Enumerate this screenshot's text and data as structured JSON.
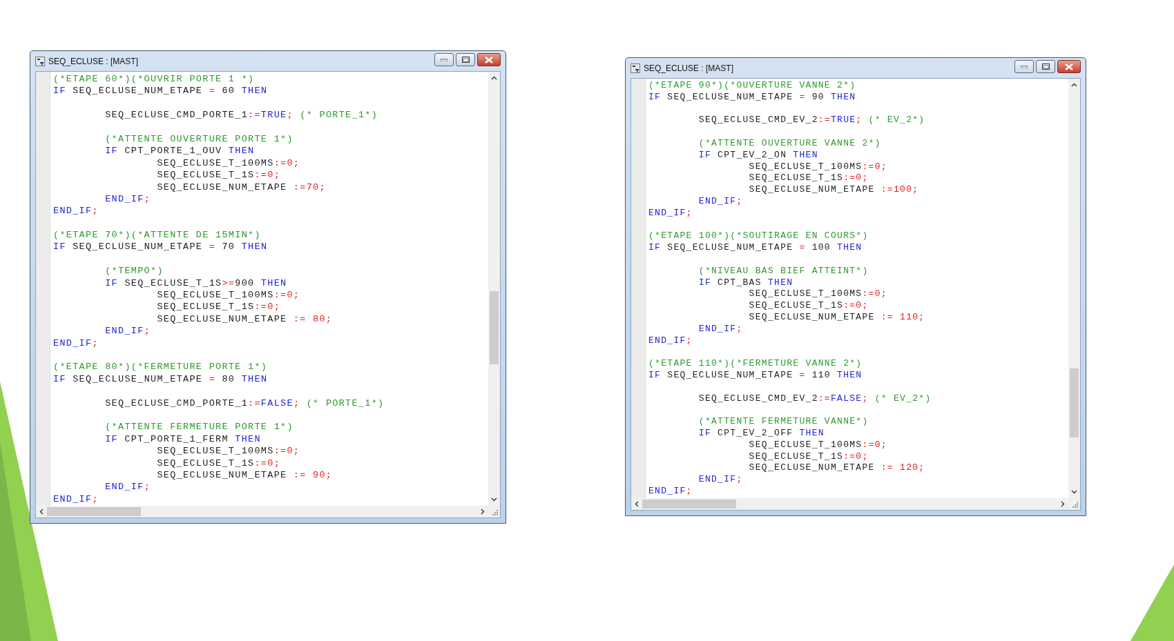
{
  "windows": [
    {
      "title": "SEQ_ECLUSE : [MAST]",
      "lines": [
        {
          "tokens": [
            {
              "kind": "comment",
              "text": "(*ETAPE 60*)(*OUVRIR PORTE 1 *)"
            }
          ]
        },
        {
          "tokens": [
            {
              "kind": "kw",
              "text": "IF"
            },
            {
              "kind": "id",
              "text": " SEQ_ECLUSE_NUM_ETAPE "
            },
            {
              "kind": "op",
              "text": "="
            },
            {
              "kind": "id",
              "text": " 60 "
            },
            {
              "kind": "kw",
              "text": "THEN"
            }
          ]
        },
        {
          "after_blank": true,
          "tokens": [
            {
              "kind": "id",
              "text": "        SEQ_ECLUSE_CMD_PORTE_1"
            },
            {
              "kind": "op",
              "text": ":="
            },
            {
              "kind": "kw",
              "text": "TRUE"
            },
            {
              "kind": "op",
              "text": ";"
            },
            {
              "kind": "comment",
              "text": " (* PORTE_1*)"
            }
          ]
        },
        {
          "after_blank": true,
          "tokens": [
            {
              "kind": "comment",
              "text": "        (*ATTENTE OUVERTURE PORTE 1*)"
            }
          ]
        },
        {
          "tokens": [
            {
              "kind": "kw",
              "text": "        IF"
            },
            {
              "kind": "id",
              "text": " CPT_PORTE_1_OUV "
            },
            {
              "kind": "kw",
              "text": "THEN"
            }
          ]
        },
        {
          "tokens": [
            {
              "kind": "id",
              "text": "                SEQ_ECLUSE_T_100MS"
            },
            {
              "kind": "op",
              "text": ":=0;"
            }
          ]
        },
        {
          "tokens": [
            {
              "kind": "id",
              "text": "                SEQ_ECLUSE_T_1S"
            },
            {
              "kind": "op",
              "text": ":=0;"
            }
          ]
        },
        {
          "tokens": [
            {
              "kind": "id",
              "text": "                SEQ_ECLUSE_NUM_ETAPE "
            },
            {
              "kind": "op",
              "text": ":=70;"
            }
          ]
        },
        {
          "tokens": [
            {
              "kind": "kw",
              "text": "        END_IF"
            },
            {
              "kind": "op",
              "text": ";"
            }
          ]
        },
        {
          "tokens": [
            {
              "kind": "kw",
              "text": "END_IF"
            },
            {
              "kind": "op",
              "text": ";"
            }
          ]
        },
        {
          "after_blank": true,
          "tokens": [
            {
              "kind": "comment",
              "text": "(*ETAPE 70*)(*ATTENTE DE 15MIN*)"
            }
          ]
        },
        {
          "tokens": [
            {
              "kind": "kw",
              "text": "IF"
            },
            {
              "kind": "id",
              "text": " SEQ_ECLUSE_NUM_ETAPE "
            },
            {
              "kind": "op",
              "text": "="
            },
            {
              "kind": "id",
              "text": " 70 "
            },
            {
              "kind": "kw",
              "text": "THEN"
            }
          ]
        },
        {
          "after_blank": true,
          "tokens": [
            {
              "kind": "comment",
              "text": "        (*TEMPO*)"
            }
          ]
        },
        {
          "tokens": [
            {
              "kind": "kw",
              "text": "        IF"
            },
            {
              "kind": "id",
              "text": " SEQ_ECLUSE_T_1S"
            },
            {
              "kind": "op",
              "text": ">="
            },
            {
              "kind": "id",
              "text": "900 "
            },
            {
              "kind": "kw",
              "text": "THEN"
            }
          ]
        },
        {
          "tokens": [
            {
              "kind": "id",
              "text": "                SEQ_ECLUSE_T_100MS"
            },
            {
              "kind": "op",
              "text": ":=0;"
            }
          ]
        },
        {
          "tokens": [
            {
              "kind": "id",
              "text": "                SEQ_ECLUSE_T_1S"
            },
            {
              "kind": "op",
              "text": ":=0;"
            }
          ]
        },
        {
          "tokens": [
            {
              "kind": "id",
              "text": "                SEQ_ECLUSE_NUM_ETAPE "
            },
            {
              "kind": "op",
              "text": ":= 80;"
            }
          ]
        },
        {
          "tokens": [
            {
              "kind": "kw",
              "text": "        END_IF"
            },
            {
              "kind": "op",
              "text": ";"
            }
          ]
        },
        {
          "tokens": [
            {
              "kind": "kw",
              "text": "END_IF"
            },
            {
              "kind": "op",
              "text": ";"
            }
          ]
        },
        {
          "after_blank": true,
          "tokens": [
            {
              "kind": "comment",
              "text": "(*ETAPE 80*)(*FERMETURE PORTE 1*)"
            }
          ]
        },
        {
          "tokens": [
            {
              "kind": "kw",
              "text": "IF"
            },
            {
              "kind": "id",
              "text": " SEQ_ECLUSE_NUM_ETAPE "
            },
            {
              "kind": "op",
              "text": "="
            },
            {
              "kind": "id",
              "text": " 80 "
            },
            {
              "kind": "kw",
              "text": "THEN"
            }
          ]
        },
        {
          "after_blank": true,
          "tokens": [
            {
              "kind": "id",
              "text": "        SEQ_ECLUSE_CMD_PORTE_1"
            },
            {
              "kind": "op",
              "text": ":="
            },
            {
              "kind": "kw",
              "text": "FALSE"
            },
            {
              "kind": "op",
              "text": ";"
            },
            {
              "kind": "comment",
              "text": " (* PORTE_1*)"
            }
          ]
        },
        {
          "after_blank": true,
          "tokens": [
            {
              "kind": "comment",
              "text": "        (*ATTENTE FERMETURE PORTE 1*)"
            }
          ]
        },
        {
          "tokens": [
            {
              "kind": "kw",
              "text": "        IF"
            },
            {
              "kind": "id",
              "text": " CPT_PORTE_1_FERM "
            },
            {
              "kind": "kw",
              "text": "THEN"
            }
          ]
        },
        {
          "tokens": [
            {
              "kind": "id",
              "text": "                SEQ_ECLUSE_T_100MS"
            },
            {
              "kind": "op",
              "text": ":=0;"
            }
          ]
        },
        {
          "tokens": [
            {
              "kind": "id",
              "text": "                SEQ_ECLUSE_T_1S"
            },
            {
              "kind": "op",
              "text": ":=0;"
            }
          ]
        },
        {
          "tokens": [
            {
              "kind": "id",
              "text": "                SEQ_ECLUSE_NUM_ETAPE "
            },
            {
              "kind": "op",
              "text": ":= 90;"
            }
          ]
        },
        {
          "tokens": [
            {
              "kind": "kw",
              "text": "        END_IF"
            },
            {
              "kind": "op",
              "text": ";"
            }
          ]
        },
        {
          "tokens": [
            {
              "kind": "kw",
              "text": "END_IF"
            },
            {
              "kind": "op",
              "text": ";"
            }
          ]
        }
      ]
    },
    {
      "title": "SEQ_ECLUSE : [MAST]",
      "lines": [
        {
          "tokens": [
            {
              "kind": "comment",
              "text": "(*ETAPE 90*)(*OUVERTURE VANNE 2*)"
            }
          ]
        },
        {
          "tokens": [
            {
              "kind": "kw",
              "text": "IF"
            },
            {
              "kind": "id",
              "text": " SEQ_ECLUSE_NUM_ETAPE "
            },
            {
              "kind": "op",
              "text": "="
            },
            {
              "kind": "id",
              "text": " 90 "
            },
            {
              "kind": "kw",
              "text": "THEN"
            }
          ]
        },
        {
          "after_blank": true,
          "tokens": [
            {
              "kind": "id",
              "text": "        SEQ_ECLUSE_CMD_EV_2"
            },
            {
              "kind": "op",
              "text": ":="
            },
            {
              "kind": "kw",
              "text": "TRUE"
            },
            {
              "kind": "op",
              "text": ";"
            },
            {
              "kind": "comment",
              "text": " (* EV_2*)"
            }
          ]
        },
        {
          "after_blank": true,
          "tokens": [
            {
              "kind": "comment",
              "text": "        (*ATTENTE OUVERTURE VANNE 2*)"
            }
          ]
        },
        {
          "tokens": [
            {
              "kind": "kw",
              "text": "        IF"
            },
            {
              "kind": "id",
              "text": " CPT_EV_2_ON "
            },
            {
              "kind": "kw",
              "text": "THEN"
            }
          ]
        },
        {
          "tokens": [
            {
              "kind": "id",
              "text": "                SEQ_ECLUSE_T_100MS"
            },
            {
              "kind": "op",
              "text": ":=0;"
            }
          ]
        },
        {
          "tokens": [
            {
              "kind": "id",
              "text": "                SEQ_ECLUSE_T_1S"
            },
            {
              "kind": "op",
              "text": ":=0;"
            }
          ]
        },
        {
          "tokens": [
            {
              "kind": "id",
              "text": "                SEQ_ECLUSE_NUM_ETAPE "
            },
            {
              "kind": "op",
              "text": ":=100;"
            }
          ]
        },
        {
          "tokens": [
            {
              "kind": "kw",
              "text": "        END_IF"
            },
            {
              "kind": "op",
              "text": ";"
            }
          ]
        },
        {
          "tokens": [
            {
              "kind": "kw",
              "text": "END_IF"
            },
            {
              "kind": "op",
              "text": ";"
            }
          ]
        },
        {
          "after_blank": true,
          "tokens": [
            {
              "kind": "comment",
              "text": "(*ETAPE 100*)(*SOUTIRAGE EN COURS*)"
            }
          ]
        },
        {
          "tokens": [
            {
              "kind": "kw",
              "text": "IF"
            },
            {
              "kind": "id",
              "text": " SEQ_ECLUSE_NUM_ETAPE "
            },
            {
              "kind": "op",
              "text": "="
            },
            {
              "kind": "id",
              "text": " 100 "
            },
            {
              "kind": "kw",
              "text": "THEN"
            }
          ]
        },
        {
          "after_blank": true,
          "tokens": [
            {
              "kind": "comment",
              "text": "        (*NIVEAU BAS BIEF ATTEINT*)"
            }
          ]
        },
        {
          "tokens": [
            {
              "kind": "kw",
              "text": "        IF"
            },
            {
              "kind": "id",
              "text": " CPT_BAS "
            },
            {
              "kind": "kw",
              "text": "THEN"
            }
          ]
        },
        {
          "tokens": [
            {
              "kind": "id",
              "text": "                SEQ_ECLUSE_T_100MS"
            },
            {
              "kind": "op",
              "text": ":=0;"
            }
          ]
        },
        {
          "tokens": [
            {
              "kind": "id",
              "text": "                SEQ_ECLUSE_T_1S"
            },
            {
              "kind": "op",
              "text": ":=0;"
            }
          ]
        },
        {
          "tokens": [
            {
              "kind": "id",
              "text": "                SEQ_ECLUSE_NUM_ETAPE "
            },
            {
              "kind": "op",
              "text": ":= 110;"
            }
          ]
        },
        {
          "tokens": [
            {
              "kind": "kw",
              "text": "        END_IF"
            },
            {
              "kind": "op",
              "text": ";"
            }
          ]
        },
        {
          "tokens": [
            {
              "kind": "kw",
              "text": "END_IF"
            },
            {
              "kind": "op",
              "text": ";"
            }
          ]
        },
        {
          "after_blank": true,
          "tokens": [
            {
              "kind": "comment",
              "text": "(*ETAPE 110*)(*FERMETURE VANNE 2*)"
            }
          ]
        },
        {
          "tokens": [
            {
              "kind": "kw",
              "text": "IF"
            },
            {
              "kind": "id",
              "text": " SEQ_ECLUSE_NUM_ETAPE "
            },
            {
              "kind": "op",
              "text": "="
            },
            {
              "kind": "id",
              "text": " 110 "
            },
            {
              "kind": "kw",
              "text": "THEN"
            }
          ]
        },
        {
          "after_blank": true,
          "tokens": [
            {
              "kind": "id",
              "text": "        SEQ_ECLUSE_CMD_EV_2"
            },
            {
              "kind": "op",
              "text": ":="
            },
            {
              "kind": "kw",
              "text": "FALSE"
            },
            {
              "kind": "op",
              "text": ";"
            },
            {
              "kind": "comment",
              "text": " (* EV_2*)"
            }
          ]
        },
        {
          "after_blank": true,
          "tokens": [
            {
              "kind": "comment",
              "text": "        (*ATTENTE FERMETURE VANNE*)"
            }
          ]
        },
        {
          "tokens": [
            {
              "kind": "kw",
              "text": "        IF"
            },
            {
              "kind": "id",
              "text": " CPT_EV_2_OFF "
            },
            {
              "kind": "kw",
              "text": "THEN"
            }
          ]
        },
        {
          "tokens": [
            {
              "kind": "id",
              "text": "                SEQ_ECLUSE_T_100MS"
            },
            {
              "kind": "op",
              "text": ":=0;"
            }
          ]
        },
        {
          "tokens": [
            {
              "kind": "id",
              "text": "                SEQ_ECLUSE_T_1S"
            },
            {
              "kind": "op",
              "text": ":=0;"
            }
          ]
        },
        {
          "tokens": [
            {
              "kind": "id",
              "text": "                SEQ_ECLUSE_NUM_ETAPE "
            },
            {
              "kind": "op",
              "text": ":= 120;"
            }
          ]
        },
        {
          "tokens": [
            {
              "kind": "kw",
              "text": "        END_IF"
            },
            {
              "kind": "op",
              "text": ";"
            }
          ]
        },
        {
          "tokens": [
            {
              "kind": "kw",
              "text": "END_IF"
            },
            {
              "kind": "op",
              "text": ";"
            }
          ]
        }
      ]
    }
  ]
}
